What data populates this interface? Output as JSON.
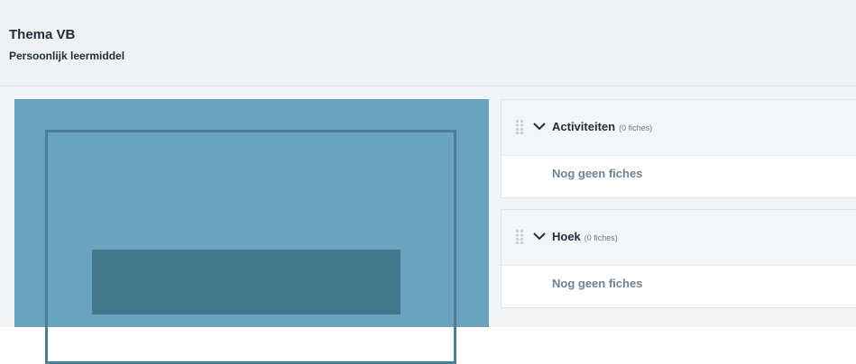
{
  "header": {
    "title": "Thema VB",
    "subtitle": "Persoonlijk leermiddel"
  },
  "sections": [
    {
      "title": "Activiteiten",
      "count": "(0 fiches)",
      "empty_text": "Nog geen fiches"
    },
    {
      "title": "Hoek",
      "count": "(0 fiches)",
      "empty_text": "Nog geen fiches"
    }
  ],
  "colors": {
    "cover_bg": "#69a3bf",
    "cover_frame": "#4a7f96",
    "cover_band": "#45788c",
    "empty_text": "#6f8294"
  },
  "icons": [
    "drag-handle-icon",
    "chevron-down-icon"
  ]
}
